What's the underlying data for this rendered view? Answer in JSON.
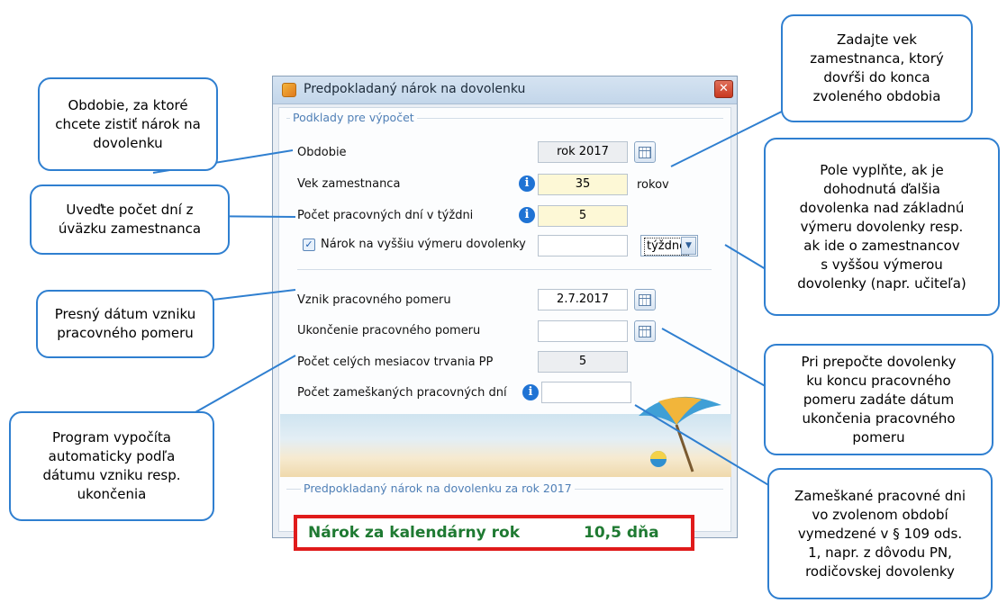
{
  "dialog": {
    "title": "Predpokladaný nárok na dovolenku",
    "close_symbol": "✕",
    "input_section": {
      "legend": "Podklady pre výpočet",
      "obdobie": {
        "label": "Obdobie",
        "value": "rok 2017"
      },
      "vek": {
        "label": "Vek zamestnanca",
        "value": "35",
        "unit": "rokov"
      },
      "dni_v_tyzdni": {
        "label": "Počet pracovných dní v týždni",
        "value": "5"
      },
      "vyssia_vymera": {
        "label": "Nárok na vyššiu výmeru dovolenky",
        "checked": true,
        "value": "",
        "unit_select": "týždne"
      },
      "vznik": {
        "label": "Vznik pracovného pomeru",
        "value": "2.7.2017"
      },
      "ukoncenie": {
        "label": "Ukončenie pracovného pomeru",
        "value": ""
      },
      "mesiace": {
        "label": "Počet celých mesiacov trvania PP",
        "value": "5"
      },
      "zameskane": {
        "label": "Počet zameškaných pracovných dní",
        "value": ""
      }
    },
    "result_section": {
      "legend": "Predpokladaný nárok na dovolenku za rok 2017",
      "label": "Nárok za kalendárny rok",
      "value": "10,5  dňa"
    }
  },
  "callouts": {
    "obdobie": [
      "Obdobie, za ktoré",
      "chcete zistiť nárok na",
      "dovolenku"
    ],
    "dni": [
      "Uveďte počet dní z",
      "úväzku zamestnanca"
    ],
    "vznik": [
      "Presný dátum vzniku",
      "pracovného pomeru"
    ],
    "mesiace": [
      "Program vypočíta",
      "automaticky podľa",
      "dátumu vzniku resp.",
      "ukončenia"
    ],
    "vek": [
      "Zadajte vek",
      "zamestnanca, ktorý",
      "dovŕši do konca",
      "zvoleného obdobia"
    ],
    "vyssia": [
      "Pole vyplňte, ak je",
      "dohodnutá ďalšia",
      "dovolenka nad základnú",
      "výmeru dovolenky resp.",
      "ak ide o zamestnancov",
      "s vyššou výmerou",
      "dovolenky (napr. učiteľa)"
    ],
    "ukoncenie": [
      "Pri prepočte dovolenky",
      "ku koncu pracovného",
      "pomeru zadáte dátum",
      "ukončenia pracovného",
      "pomeru"
    ],
    "zameskane": [
      "Zameškané pracovné dni",
      "vo zvolenom období",
      "vymedzené v § 109 ods.",
      "1, napr. z dôvodu PN,",
      "rodičovskej dovolenky"
    ]
  },
  "colors": {
    "callout_border": "#2f7fd0",
    "result_border": "#e01b1b",
    "result_text": "#1f7a32",
    "info_icon": "#1f73d4"
  }
}
